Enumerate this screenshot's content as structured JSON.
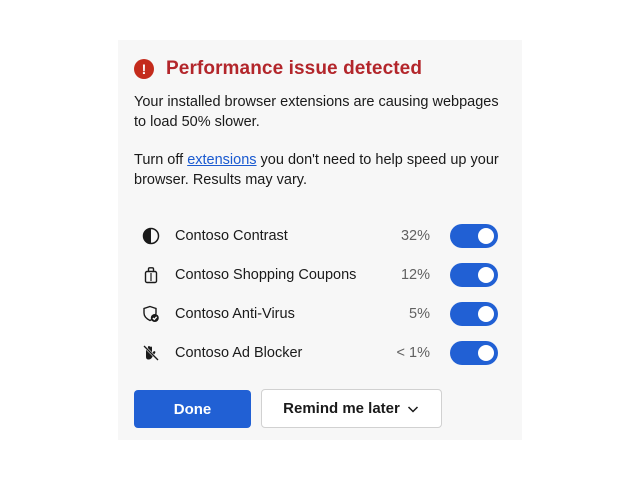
{
  "header": {
    "alert_icon": "exclamation-circle-icon",
    "title": "Performance issue detected"
  },
  "description": {
    "line1": "Your installed browser extensions are causing webpages to load 50% slower.",
    "line2_prefix": "Turn off ",
    "line2_link": "extensions",
    "line2_suffix": " you don't need to help speed up your browser. Results may vary."
  },
  "extensions": [
    {
      "name": "Contoso Contrast",
      "impact": "32%",
      "icon": "contrast-icon",
      "enabled": true
    },
    {
      "name": "Contoso Shopping Coupons",
      "impact": "12%",
      "icon": "shopping-bag-icon",
      "enabled": true
    },
    {
      "name": "Contoso Anti-Virus",
      "impact": "5%",
      "icon": "shield-check-icon",
      "enabled": true
    },
    {
      "name": "Contoso Ad Blocker",
      "impact": "< 1%",
      "icon": "hand-block-icon",
      "enabled": true
    }
  ],
  "buttons": {
    "done_label": "Done",
    "remind_label": "Remind me later"
  },
  "colors": {
    "title": "#b3262b",
    "alert": "#c42b1c",
    "accent": "#2160d4",
    "link": "#1a5ad0"
  }
}
